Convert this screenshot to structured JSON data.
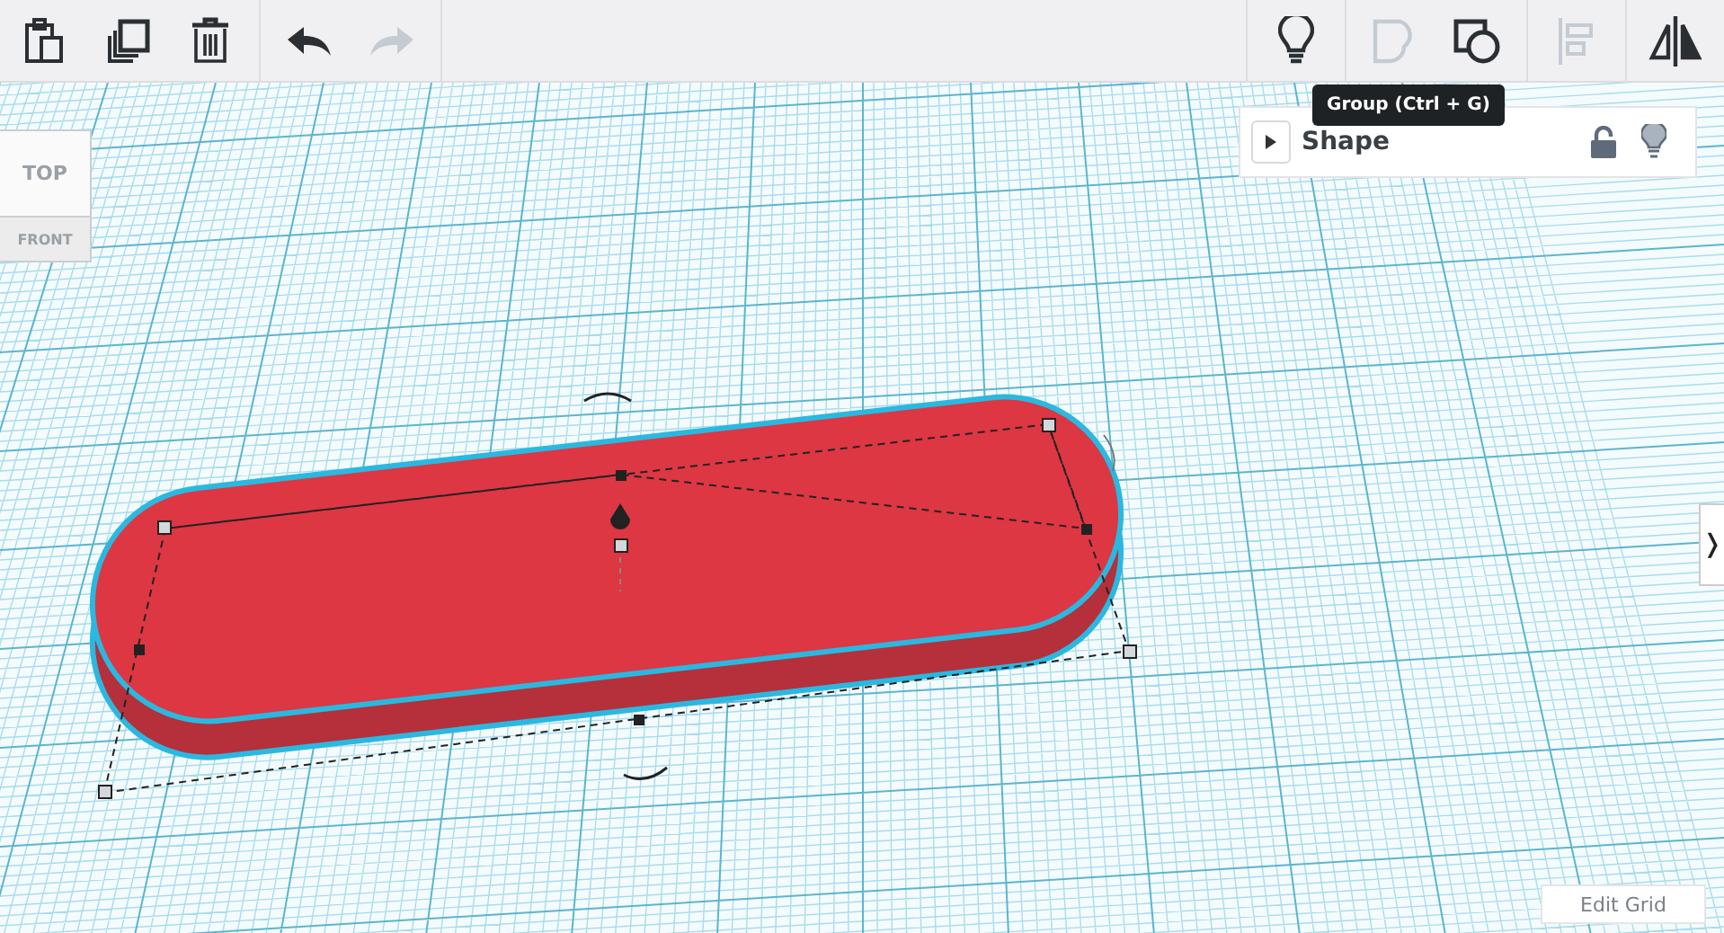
{
  "toolbar": {
    "buttons": [
      {
        "kind": "paste",
        "disabled": false
      },
      {
        "kind": "duplicate",
        "disabled": false
      },
      {
        "kind": "delete",
        "disabled": false
      },
      {
        "kind": "undo",
        "disabled": false
      },
      {
        "kind": "redo",
        "disabled": true
      },
      {
        "kind": "bulb",
        "disabled": false
      },
      {
        "kind": "group",
        "disabled": true
      },
      {
        "kind": "solid-hole",
        "disabled": false
      },
      {
        "kind": "align",
        "disabled": true
      },
      {
        "kind": "mirror",
        "disabled": false
      }
    ]
  },
  "tooltip": "Group (Ctrl + G)",
  "view_cube": {
    "top": "TOP",
    "front": "FRONT"
  },
  "shape_panel": {
    "title": "Shape",
    "expanded": false,
    "locked": false
  },
  "side_toggle": "❭",
  "edit_grid": "Edit Grid"
}
